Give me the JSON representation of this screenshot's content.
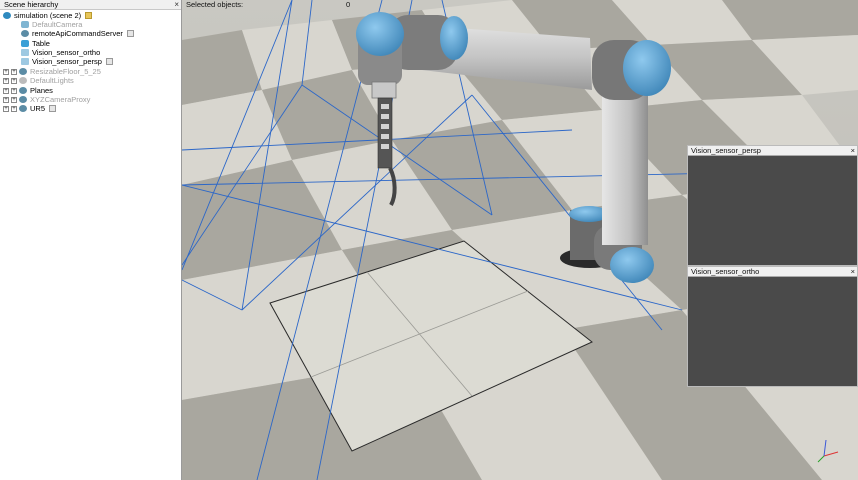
{
  "hierarchy": {
    "title": "Scene hierarchy",
    "close": "×",
    "items": [
      {
        "label": "simulation (scene 2)",
        "icon": "world-icon",
        "dimmed": false
      },
      {
        "label": "DefaultCamera",
        "icon": "camera-icon",
        "dimmed": true
      },
      {
        "label": "remoteApiCommandServer",
        "icon": "model-icon",
        "dimmed": false
      },
      {
        "label": "Table",
        "icon": "shape-icon",
        "dimmed": false
      },
      {
        "label": "Vision_sensor_ortho",
        "icon": "vision-sensor-icon",
        "dimmed": false
      },
      {
        "label": "Vision_sensor_persp",
        "icon": "vision-sensor-icon",
        "dimmed": false
      },
      {
        "label": "ResizableFloor_5_25",
        "icon": "model-icon",
        "dimmed": true
      },
      {
        "label": "DefaultLights",
        "icon": "light-icon",
        "dimmed": true
      },
      {
        "label": "Planes",
        "icon": "model-icon",
        "dimmed": false
      },
      {
        "label": "XYZCameraProxy",
        "icon": "model-icon",
        "dimmed": true
      },
      {
        "label": "UR5",
        "icon": "model-icon",
        "dimmed": false
      }
    ]
  },
  "viewport": {
    "selected_label": "Selected objects:",
    "selected_count": "0"
  },
  "vision_windows": [
    {
      "title": "Vision_sensor_persp",
      "close": "×"
    },
    {
      "title": "Vision_sensor_ortho",
      "close": "×"
    }
  ],
  "colors": {
    "floor_light": "#d8d6cf",
    "floor_dark": "#a9a79f",
    "robot_blue": "#5ea9d8",
    "robot_grey": "#b8b8b8",
    "vision_bg": "#4a4a4a",
    "ray_blue": "#2c67c8"
  }
}
